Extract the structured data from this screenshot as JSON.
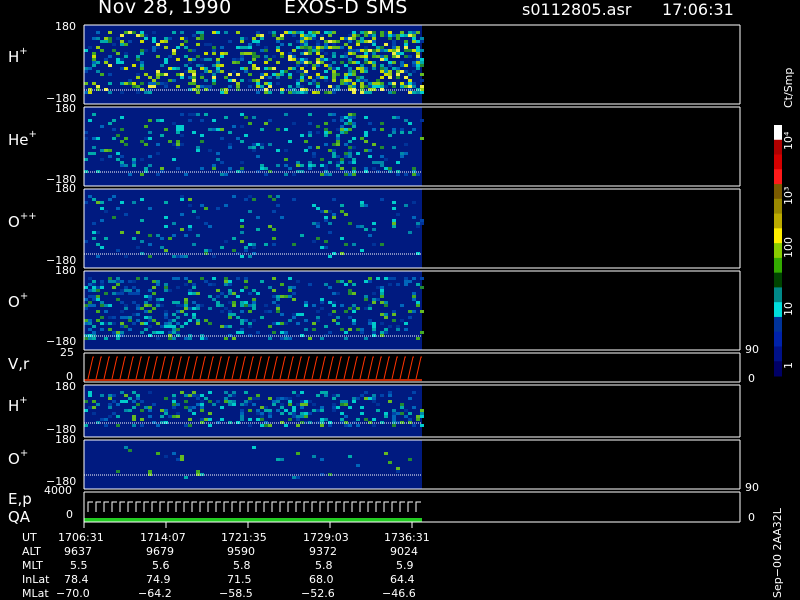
{
  "header": {
    "date": "Nov 28, 1990",
    "instrument": "EXOS-D SMS",
    "file": "s0112805.asr",
    "time": "17:06:31"
  },
  "panels": [
    {
      "id": "h1",
      "label": "H",
      "sup": "+",
      "top": "180",
      "bottom": "−180"
    },
    {
      "id": "he",
      "label": "He",
      "sup": "+",
      "top": "180",
      "bottom": "−180"
    },
    {
      "id": "opp",
      "label": "O",
      "sup": "++",
      "top": "180",
      "bottom": "−180"
    },
    {
      "id": "o1",
      "label": "O",
      "sup": "+",
      "top": "180",
      "bottom": "−180"
    },
    {
      "id": "vr",
      "label": "V,r",
      "sup": "",
      "top": "25",
      "bottom": "0",
      "right_top": "90",
      "right_bottom": "0"
    },
    {
      "id": "h2",
      "label": "H",
      "sup": "+",
      "top": "180",
      "bottom": "−180"
    },
    {
      "id": "o2",
      "label": "O",
      "sup": "+",
      "top": "180",
      "bottom": "−180"
    },
    {
      "id": "ep",
      "label": "E,p",
      "label2": "QA",
      "sup": "",
      "top": "4000",
      "bottom": "0",
      "right_top": "90",
      "right_bottom": "0"
    }
  ],
  "colorbar": {
    "unit": "Ct/Smp",
    "ticks": [
      "10⁴",
      "10³",
      "100",
      "10",
      "1"
    ],
    "colors": [
      "#ffffff",
      "#b00000",
      "#d40000",
      "#ff1a1a",
      "#7a5a00",
      "#998800",
      "#bbaa00",
      "#ffee00",
      "#88cc00",
      "#33aa00",
      "#004400",
      "#008888",
      "#00dddd",
      "#003399",
      "#0022aa",
      "#001188",
      "#000066"
    ]
  },
  "ephemeris": {
    "labels": [
      "UT",
      "ALT",
      "MLT",
      "InLat",
      "MLat"
    ],
    "columns": [
      [
        "1706:31",
        "9637",
        "5.5",
        "78.4",
        "−70.0"
      ],
      [
        "1714:07",
        "9679",
        "5.6",
        "74.9",
        "−64.2"
      ],
      [
        "1721:35",
        "9590",
        "5.8",
        "71.5",
        "−58.5"
      ],
      [
        "1729:03",
        "9372",
        "5.8",
        "68.0",
        "−52.6"
      ],
      [
        "1736:31",
        "9024",
        "5.9",
        "64.4",
        "−46.6"
      ]
    ]
  },
  "footer_vertical": "Sep−00  2AA32L",
  "chart_data": {
    "type": "heatmap",
    "title": "Nov 28, 1990   EXOS-D SMS",
    "x": [
      "1706:31",
      "1714:07",
      "1721:35",
      "1729:03",
      "1736:31"
    ],
    "ylim": [
      -180,
      180
    ],
    "colorbar_range": [
      1,
      10000
    ],
    "colorbar_scale": "log",
    "series": [
      {
        "name": "H+",
        "ylim": [
          -180,
          180
        ]
      },
      {
        "name": "He+",
        "ylim": [
          -180,
          180
        ]
      },
      {
        "name": "O++",
        "ylim": [
          -180,
          180
        ]
      },
      {
        "name": "O+",
        "ylim": [
          -180,
          180
        ]
      },
      {
        "name": "V,r",
        "ylim": [
          0,
          25
        ]
      },
      {
        "name": "H+",
        "ylim": [
          -180,
          180
        ]
      },
      {
        "name": "O+",
        "ylim": [
          -180,
          180
        ]
      },
      {
        "name": "E,p",
        "ylim": [
          0,
          4000
        ]
      }
    ]
  }
}
